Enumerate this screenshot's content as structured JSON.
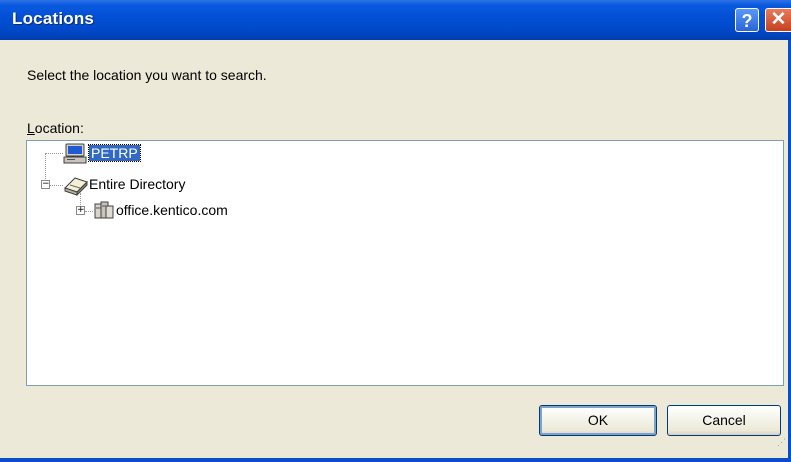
{
  "window": {
    "title": "Locations",
    "help_symbol": "?",
    "close_symbol": "✕"
  },
  "instruction": "Select the location you want to search.",
  "location_label": {
    "accel": "L",
    "rest": "ocation:"
  },
  "tree": {
    "items": [
      {
        "label": "PETRP",
        "icon": "computer-icon",
        "selected": true,
        "expander": ""
      },
      {
        "label": "Entire Directory",
        "icon": "directory-book-icon",
        "selected": false,
        "expander": "−"
      },
      {
        "label": "office.kentico.com",
        "icon": "domain-icon",
        "selected": false,
        "expander": "+"
      }
    ]
  },
  "buttons": {
    "ok": "OK",
    "cancel": "Cancel"
  },
  "colors": {
    "titlebar": "#0350d6",
    "selection": "#316ac5",
    "dialog_bg": "#ece9d8"
  }
}
